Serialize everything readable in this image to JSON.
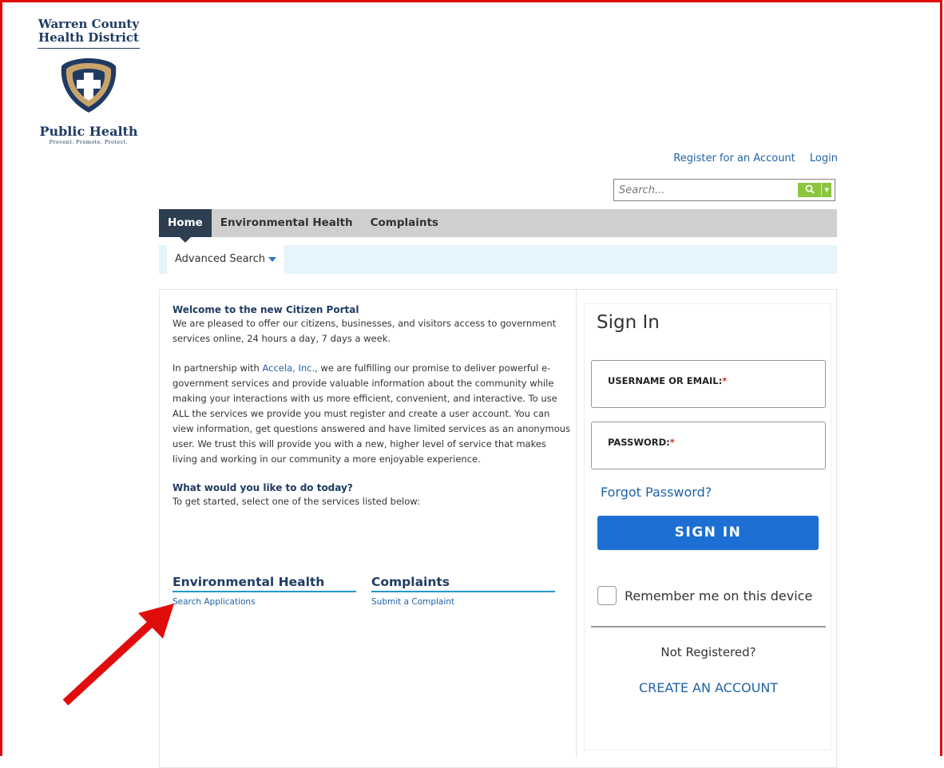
{
  "logo": {
    "line1": "Warren County",
    "line2": "Health District",
    "brand": "Public Health",
    "tagline": "Prevent. Promote. Protect."
  },
  "header": {
    "register_label": "Register for an Account",
    "login_label": "Login",
    "search_placeholder": "Search..."
  },
  "nav": {
    "tabs": [
      {
        "label": "Home",
        "active": true
      },
      {
        "label": "Environmental Health",
        "active": false
      },
      {
        "label": "Complaints",
        "active": false
      }
    ],
    "advanced_search_label": "Advanced Search"
  },
  "welcome": {
    "title": "Welcome to the new Citizen Portal",
    "intro": "We are pleased to offer our citizens, businesses, and visitors access to government services online, 24 hours a day, 7 days a week.",
    "p2_before": "In partnership with ",
    "p2_link": "Accela, Inc.",
    "p2_after": ", we are fulfilling our promise to deliver powerful e-government services and provide valuable information about the community while making your interactions with us more efficient, convenient, and interactive. To use ALL the services we provide you must register and create a user account. You can view information, get questions answered and have limited services as an anonymous user. We trust this will provide you with a new, higher level of service that makes living and working in our community a more enjoyable experience.",
    "question": "What would you like to do today?",
    "instruction": "To get started, select one of the services listed below:"
  },
  "services": [
    {
      "title": "Environmental Health",
      "link": "Search Applications"
    },
    {
      "title": "Complaints",
      "link": "Submit a Complaint"
    }
  ],
  "signin": {
    "title": "Sign In",
    "username_label": "USERNAME OR EMAIL:",
    "password_label": "PASSWORD:",
    "required_mark": "*",
    "forgot_label": "Forgot Password?",
    "button_label": "SIGN IN",
    "remember_label": "Remember me on this device",
    "not_registered": "Not Registered?",
    "create_label": "CREATE AN ACCOUNT"
  },
  "colors": {
    "brand_navy": "#1f3b63",
    "link_blue": "#1f63a6",
    "signin_blue": "#1d6fd3",
    "search_green": "#8cc63f",
    "annotation_red": "#e10d0d"
  }
}
